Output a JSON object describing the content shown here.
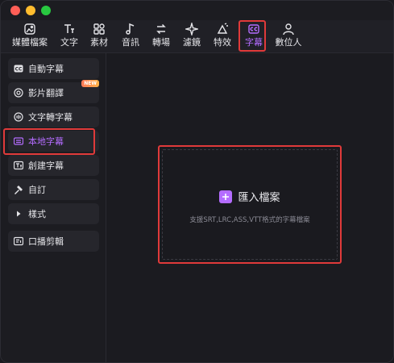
{
  "toolbar": {
    "items": [
      {
        "label": "媒體檔案",
        "icon": "media-icon"
      },
      {
        "label": "文字",
        "icon": "text-icon"
      },
      {
        "label": "素材",
        "icon": "assets-icon"
      },
      {
        "label": "音訊",
        "icon": "audio-icon"
      },
      {
        "label": "轉場",
        "icon": "transition-icon"
      },
      {
        "label": "濾鏡",
        "icon": "filter-icon"
      },
      {
        "label": "特效",
        "icon": "effects-icon"
      },
      {
        "label": "字幕",
        "icon": "subtitle-icon",
        "active": true
      },
      {
        "label": "數位人",
        "icon": "avatar-icon"
      }
    ]
  },
  "sidebar": {
    "items": [
      {
        "label": "自動字幕",
        "icon": "cc-icon"
      },
      {
        "label": "影片翻譯",
        "icon": "translate-icon",
        "badge": "NEW"
      },
      {
        "label": "文字轉字幕",
        "icon": "text-to-subtitle-icon"
      },
      {
        "label": "本地字幕",
        "icon": "local-subtitle-icon",
        "active": true
      },
      {
        "label": "創建字幕",
        "icon": "create-subtitle-icon"
      },
      {
        "label": "自訂",
        "icon": "custom-icon"
      },
      {
        "label": "樣式",
        "icon": "caret-right-icon"
      },
      {
        "label": "口播剪輯",
        "icon": "speech-edit-icon"
      }
    ]
  },
  "main": {
    "import_label": "匯入檔案",
    "hint": "支援SRT,LRC,ASS,VTT格式的字幕檔案"
  },
  "colors": {
    "accent": "#b46cff",
    "highlight": "#e03a3a"
  }
}
